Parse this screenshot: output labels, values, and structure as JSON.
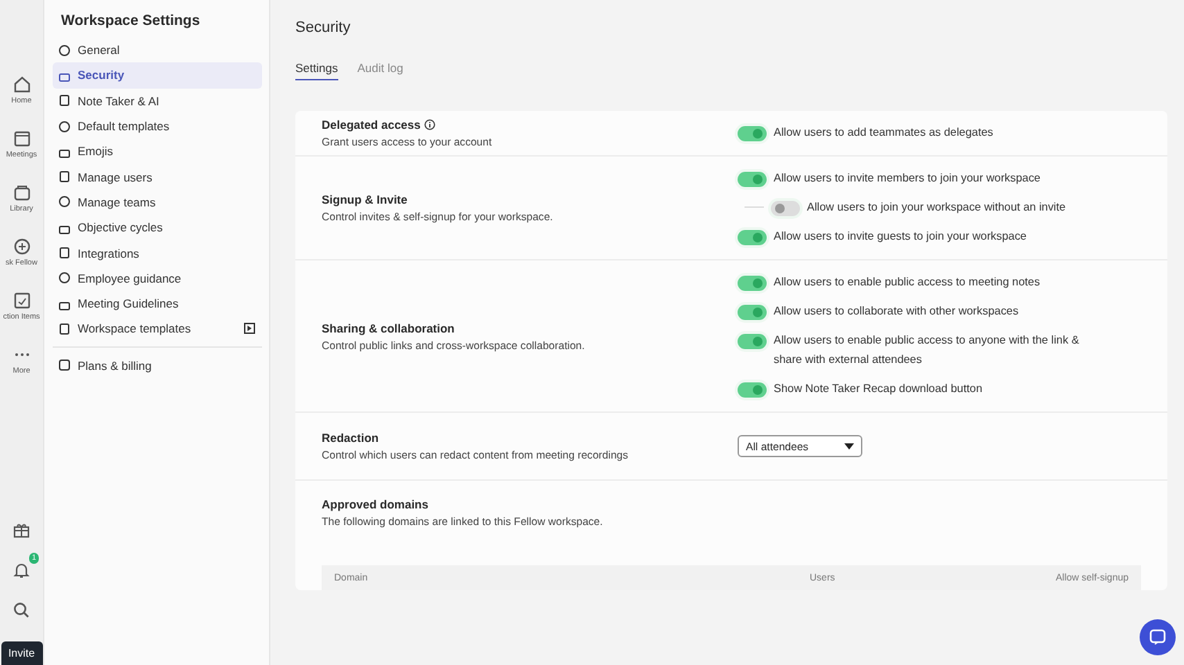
{
  "rail": {
    "items": [
      {
        "label": "Home",
        "selected": false
      },
      {
        "label": "Meetings",
        "selected": false
      },
      {
        "label": "Library",
        "selected": false
      },
      {
        "label": "sk Fellow",
        "selected": false
      },
      {
        "label": "ction Items",
        "selected": false
      },
      {
        "label": "More",
        "selected": false
      }
    ],
    "notification_count": "1",
    "invite_button": "Invite"
  },
  "sidebar": {
    "title": "Workspace Settings",
    "items": [
      {
        "label": "General",
        "selected": false,
        "action_icon": false
      },
      {
        "label": "Security",
        "selected": true,
        "action_icon": false
      },
      {
        "label": "Note Taker & AI",
        "selected": false,
        "action_icon": false
      },
      {
        "label": "Default templates",
        "selected": false,
        "action_icon": false
      },
      {
        "label": "Emojis",
        "selected": false,
        "action_icon": false
      },
      {
        "label": "Manage users",
        "selected": false,
        "action_icon": false
      },
      {
        "label": "Manage teams",
        "selected": false,
        "action_icon": false
      },
      {
        "label": "Objective cycles",
        "selected": false,
        "action_icon": false
      },
      {
        "label": "Integrations",
        "selected": false,
        "action_icon": false
      },
      {
        "label": "Employee guidance",
        "selected": false,
        "action_icon": false
      },
      {
        "label": "Meeting Guidelines",
        "selected": false,
        "action_icon": false
      },
      {
        "label": "Workspace templates",
        "selected": false,
        "action_icon": true
      }
    ],
    "footer_items": [
      {
        "label": "Plans & billing",
        "selected": false
      }
    ]
  },
  "page": {
    "title": "Security",
    "tabs": [
      {
        "label": "Settings",
        "selected": true
      },
      {
        "label": "Audit log",
        "selected": false
      }
    ]
  },
  "sections": [
    {
      "kind": "toggles",
      "title": "Delegated access",
      "info": true,
      "description": "Grant users access to your account",
      "options": [
        {
          "label": "Allow users to add teammates as delegates",
          "on": true,
          "nested": false
        }
      ]
    },
    {
      "kind": "toggles",
      "title": "Signup & Invite",
      "info": false,
      "description": "Control invites & self-signup for your workspace.",
      "options": [
        {
          "label": "Allow users to invite members to join your workspace",
          "on": true,
          "nested": false
        },
        {
          "label": "Allow users to join your workspace without an invite",
          "on": false,
          "nested": true
        },
        {
          "label": "Allow users to invite guests to join your workspace",
          "on": true,
          "nested": false
        }
      ]
    },
    {
      "kind": "toggles",
      "title": "Sharing & collaboration",
      "info": false,
      "description": "Control public links and cross-workspace collaboration.",
      "options": [
        {
          "label": "Allow users to enable public access to meeting notes",
          "on": true,
          "nested": false
        },
        {
          "label": "Allow users to collaborate with other workspaces",
          "on": true,
          "nested": false
        },
        {
          "label": "Allow users to enable public access to anyone with the link & share with external attendees",
          "on": true,
          "nested": false
        },
        {
          "label": "Show Note Taker Recap download button",
          "on": true,
          "nested": false
        }
      ]
    },
    {
      "kind": "select",
      "title": "Redaction",
      "info": false,
      "description": "Control which users can redact content from meeting recordings",
      "value": "All attendees"
    },
    {
      "kind": "domains",
      "title": "Approved domains",
      "info": false,
      "description": "The following domains are linked to this Fellow workspace.",
      "columns": [
        "Domain",
        "Users",
        "Allow self-signup"
      ]
    }
  ]
}
